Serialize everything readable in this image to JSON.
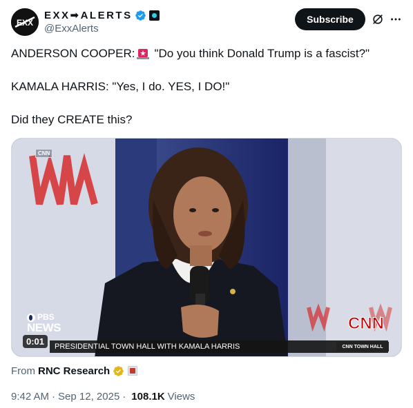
{
  "author": {
    "display_name": "EXX➡ALERTS",
    "handle": "@ExxAlerts",
    "avatar_text": "EXX"
  },
  "actions": {
    "subscribe_label": "Subscribe"
  },
  "tweet": {
    "lines": [
      "ANDERSON COOPER: 🚨 \"Do you think Donald Trump is a fascist?\"",
      "KAMALA HARRIS: \"Yes, I do. YES, I DO!\"",
      "Did they CREATE this?"
    ],
    "line1_prefix": "ANDERSON COOPER:",
    "line1_quote": "\"Do you think Donald Trump is a fascist?\"",
    "line2": "KAMALA HARRIS: \"Yes, I do. YES, I DO!\"",
    "line3": "Did they CREATE this?"
  },
  "video": {
    "cnn_tag": "CNN",
    "pbs_label": "PBS",
    "news_label": "NEWS",
    "time": "0:01",
    "chyron": "PRESIDENTIAL TOWN HALL WITH KAMALA HARRIS",
    "chyron_right": "CNN TOWN HALL",
    "cnn_bug": "CNN"
  },
  "source": {
    "from_label": "From",
    "name": "RNC Research"
  },
  "meta": {
    "time": "9:42 AM",
    "date": "Sep 12, 2025",
    "views_count": "108.1K",
    "views_label": "Views"
  },
  "colors": {
    "verified_blue": "#1d9bf0",
    "gold_badge": "#e2b719",
    "cnn_red": "#cc0000",
    "subscribe_bg": "#0f1419"
  }
}
